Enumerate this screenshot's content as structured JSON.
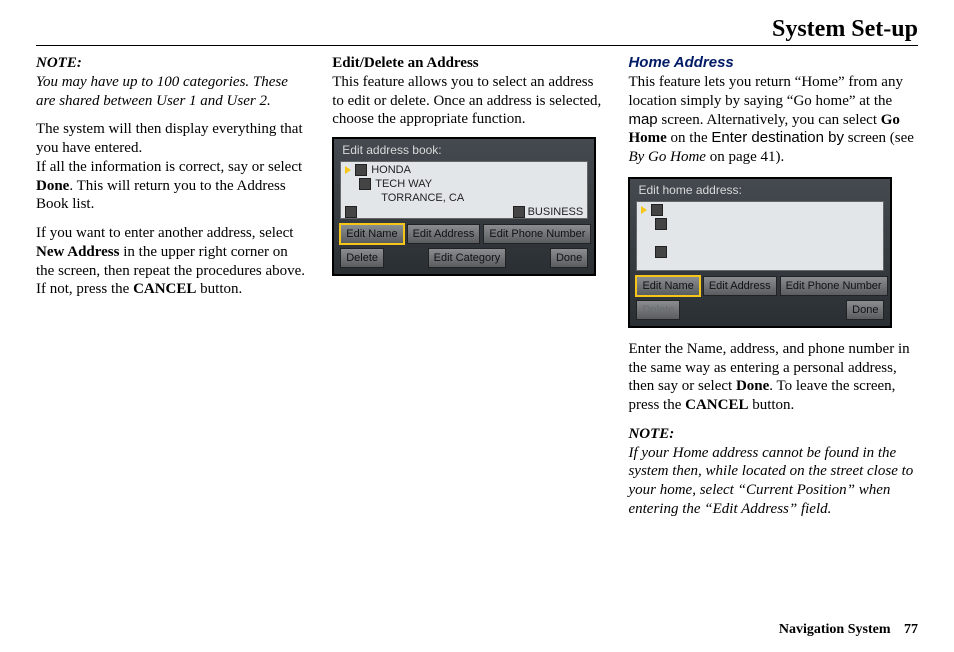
{
  "page_title": "System Set-up",
  "footer": {
    "label": "Navigation System",
    "page": "77"
  },
  "col1": {
    "note_label": "NOTE:",
    "note_body": "You may have up to 100 categories. These are shared between User 1 and User 2.",
    "p1_a": "The system will then display everything that you have entered.",
    "p1_b_pre": "If all the information is correct, say or select ",
    "p1_b_bold": "Done",
    "p1_b_post": ". This will return you to the Address Book list.",
    "p2_pre": "If you want to enter another address, select ",
    "p2_bold1": "New Address",
    "p2_mid": " in the upper right corner on the screen, then repeat the procedures above. If not, press the ",
    "p2_bold2": "CANCEL",
    "p2_post": " button."
  },
  "col2": {
    "heading": "Edit/Delete an Address",
    "body": "This feature allows you to select an address to edit or delete. Once an address is selected, choose the appropriate function.",
    "shot": {
      "title": "Edit address book:",
      "name": "HONDA",
      "street": "TECH WAY",
      "city": "TORRANCE, CA",
      "category": "BUSINESS",
      "btn_edit_name": "Edit Name",
      "btn_edit_addr": "Edit Address",
      "btn_edit_phone": "Edit Phone Number",
      "btn_delete": "Delete",
      "btn_edit_cat": "Edit Category",
      "btn_done": "Done"
    }
  },
  "col3": {
    "heading": "Home Address",
    "p1_a": "This feature lets you return “Home” from any location simply by saying “Go home” at the ",
    "p1_sans1": "map",
    "p1_b": " screen. Alternatively, you can select ",
    "p1_bold": "Go Home",
    "p1_c": " on the ",
    "p1_sans2": "Enter destination by",
    "p1_d": " screen (see ",
    "p1_ital": "By Go Home",
    "p1_e": " on page 41).",
    "shot": {
      "title": "Edit home address:",
      "btn_edit_name": "Edit Name",
      "btn_edit_addr": "Edit Address",
      "btn_edit_phone": "Edit Phone Number",
      "btn_delete": "Delete",
      "btn_done": "Done"
    },
    "p2_pre": "Enter the Name, address, and phone number in the same way as entering a personal address, then say or select ",
    "p2_bold1": "Done",
    "p2_mid": ". To leave the screen, press the ",
    "p2_bold2": "CANCEL",
    "p2_post": " button.",
    "note_label": "NOTE:",
    "note_body": "If your Home address cannot be found in the system then, while located on the street close to your home, select “Current Position” when entering the “Edit Address” field."
  }
}
